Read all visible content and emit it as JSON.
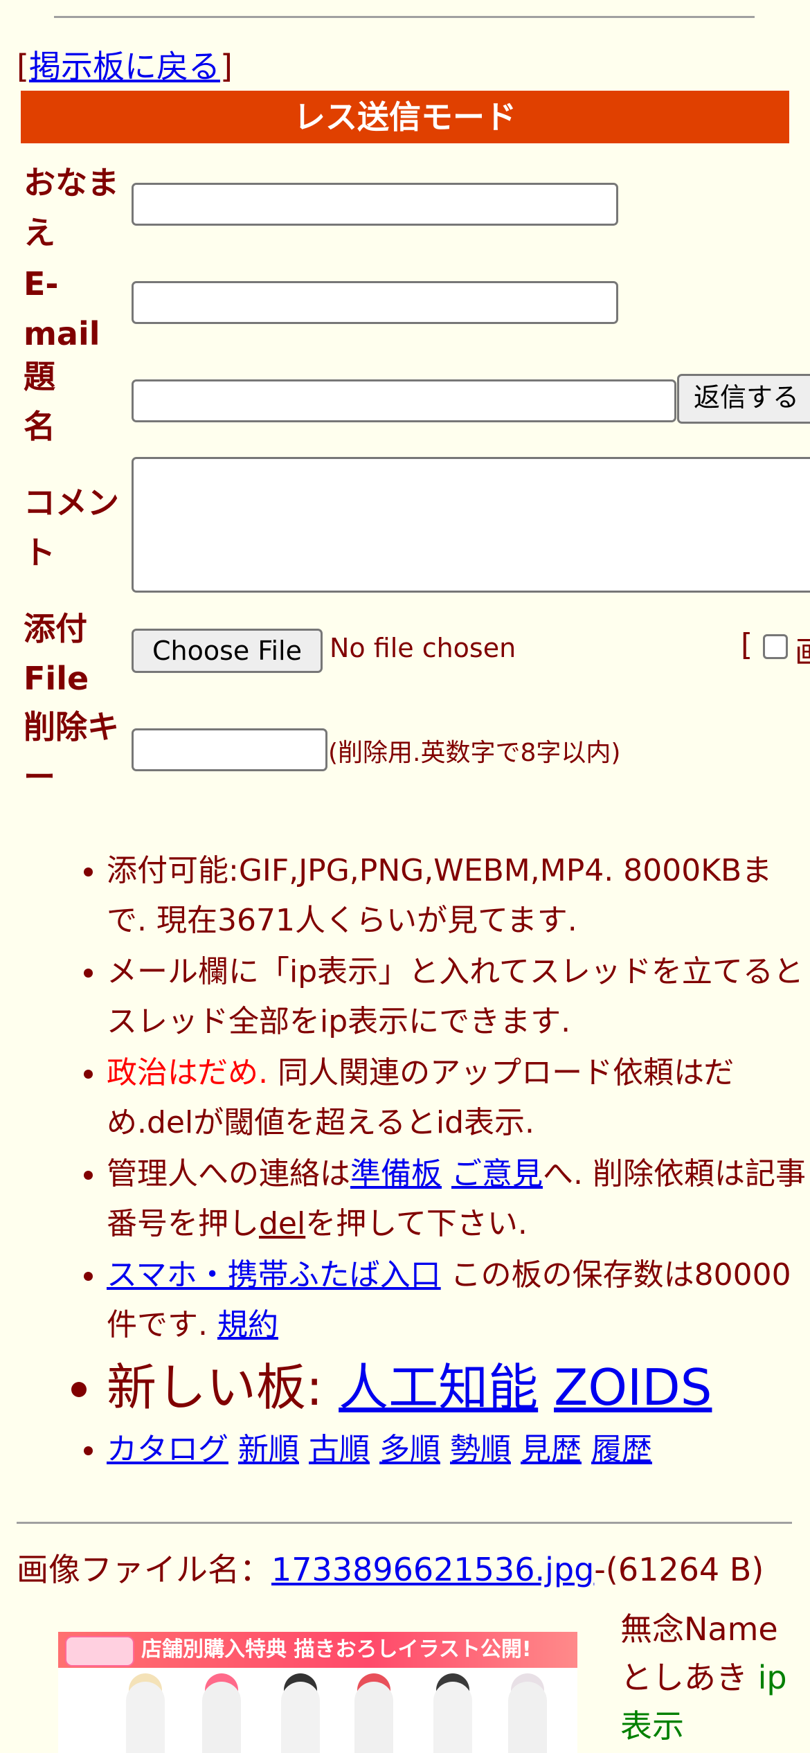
{
  "nav": {
    "back_open": "[",
    "back_link": "掲示板に戻る",
    "back_close": "]"
  },
  "form": {
    "mode_title": "レス送信モード",
    "name_label": "おなまえ",
    "email_label": "E-mail",
    "subject_label": "題名",
    "comment_label": "コメント",
    "file_label": "添付File",
    "delkey_label": "削除キー",
    "submit_label": "返信する",
    "choose_file_label": "Choose File",
    "no_file_text": "No file chosen",
    "bracket_text": "[",
    "image_option_partial": "画",
    "delkey_note": "(削除用.英数字で8字以内)"
  },
  "notes": {
    "n1": "添付可能:GIF,JPG,PNG,WEBM,MP4. 8000KBまで. 現在3671人くらいが見てます.",
    "n2": "メール欄に「ip表示」と入れてスレッドを立てるとスレッド全部をip表示にできます.",
    "n3_red": "政治はだめ.",
    "n3_rest": " 同人関連のアップロード依頼はだめ.delが閾値を超えるとid表示.",
    "n4_pre": "管理人への連絡は",
    "n4_link1": "準備板",
    "n4_space": " ",
    "n4_link2": "ご意見",
    "n4_mid": "へ. 削除依頼は記事番号を押し",
    "n4_link3": "del",
    "n4_post": "を押して下さい.",
    "n5_link": "スマホ・携帯ふたば入口",
    "n5_mid": " この板の保存数は80000件です. ",
    "n5_link2": "規約",
    "n6_pre": "新しい板: ",
    "n6_link1": "人工知能",
    "n6_link2": "ZOIDS",
    "links": [
      "カタログ",
      "新順",
      "古順",
      "多順",
      "勢順",
      "見歴",
      "履歴"
    ]
  },
  "post": {
    "file_prefix": "画像ファイル名：",
    "file_name": "1733896621536.jpg",
    "file_size": "-(61264 B)",
    "thumb_banner": "店舗別購入特典 描きおろしイラスト公開!",
    "subject": "無念",
    "name": "Name",
    "poster": "としあき",
    "ip": "ip表示"
  },
  "colors": {
    "accent": "#e04000",
    "background": "#ffffee",
    "text": "#800000",
    "link": "#0000ee"
  }
}
